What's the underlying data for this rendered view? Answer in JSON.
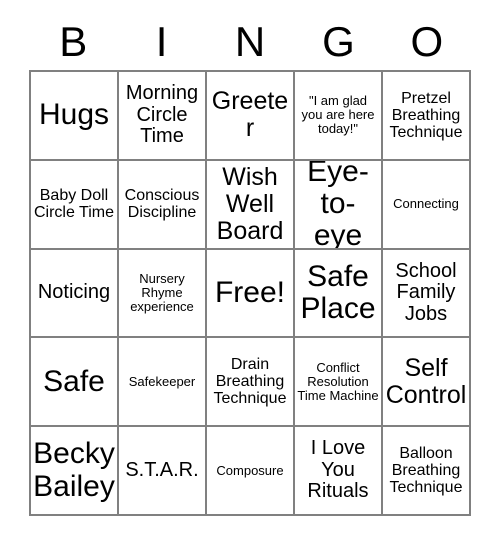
{
  "card": {
    "header": {
      "letters": [
        "B",
        "I",
        "N",
        "G",
        "O"
      ]
    },
    "rows": [
      [
        {
          "text": "Hugs",
          "size": "fs-xl"
        },
        {
          "text": "Morning Circle Time",
          "size": "fs-md"
        },
        {
          "text": "Greeter",
          "size": "fs-lg"
        },
        {
          "text": "\"I am glad you are here today!\"",
          "size": "fs-xs"
        },
        {
          "text": "Pretzel Breathing Technique",
          "size": "fs-sm"
        }
      ],
      [
        {
          "text": "Baby Doll Circle Time",
          "size": "fs-sm"
        },
        {
          "text": "Conscious Discipline",
          "size": "fs-sm"
        },
        {
          "text": "Wish Well Board",
          "size": "fs-lg"
        },
        {
          "text": "Eye-to-eye",
          "size": "fs-xl"
        },
        {
          "text": "Connecting",
          "size": "fs-xs"
        }
      ],
      [
        {
          "text": "Noticing",
          "size": "fs-md"
        },
        {
          "text": "Nursery Rhyme experience",
          "size": "fs-xs"
        },
        {
          "text": "Free!",
          "size": "fs-xl"
        },
        {
          "text": "Safe Place",
          "size": "fs-xl"
        },
        {
          "text": "School Family Jobs",
          "size": "fs-md"
        }
      ],
      [
        {
          "text": "Safe",
          "size": "fs-xl"
        },
        {
          "text": "Safekeeper",
          "size": "fs-xs"
        },
        {
          "text": "Drain Breathing Technique",
          "size": "fs-sm"
        },
        {
          "text": "Conflict Resolution Time Machine",
          "size": "fs-xs"
        },
        {
          "text": "Self Control",
          "size": "fs-lg"
        }
      ],
      [
        {
          "text": "Becky Bailey",
          "size": "fs-xl"
        },
        {
          "text": "S.T.A.R.",
          "size": "fs-md"
        },
        {
          "text": "Composure",
          "size": "fs-xs"
        },
        {
          "text": "I Love You Rituals",
          "size": "fs-md"
        },
        {
          "text": "Balloon Breathing Technique",
          "size": "fs-sm"
        }
      ]
    ]
  }
}
